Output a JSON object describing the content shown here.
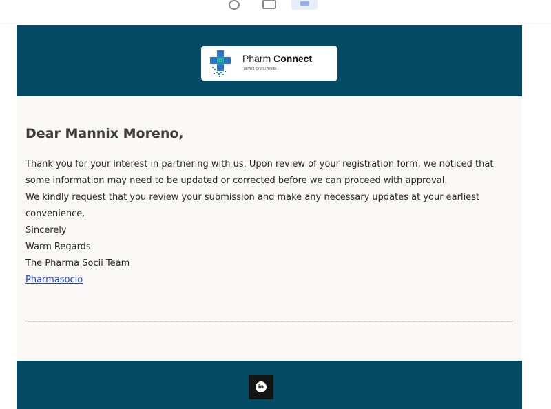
{
  "toolbar": {
    "icons": [
      "circle-icon",
      "message-icon",
      "highlighted-icon"
    ]
  },
  "email": {
    "logo": {
      "brand_regular": "Pharm ",
      "brand_bold": "Connect",
      "tagline": "perfect for you health..."
    },
    "greeting": "Dear Mannix Moreno,",
    "paragraph_1": "Thank you for your interest in partnering with us. Upon review of your registration form, we noticed that some information may need to be updated or corrected before we can proceed with approval.",
    "paragraph_2": "We kindly request that you review your submission and make any necessary updates at your earliest convenience.",
    "closing_1": "Sincerely",
    "closing_2": "Warm Regards",
    "team": "The Pharma Socii Team",
    "signature_link": "Pharmasocio",
    "footer": {
      "social_icon": "linkedin-icon",
      "social_glyph": "in"
    }
  },
  "colors": {
    "band": "#034a65",
    "background": "#f9f8f7",
    "link": "#1a3fd6",
    "logo_blue": "#2a73c8",
    "logo_teal": "#1fa6a0"
  }
}
